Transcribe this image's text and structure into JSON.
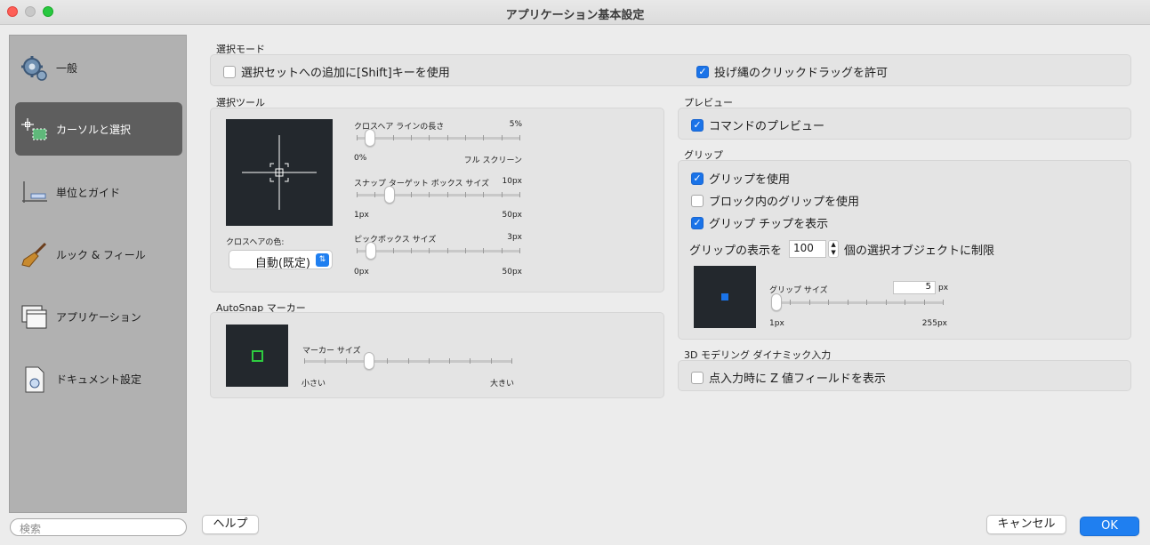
{
  "window": {
    "title": "アプリケーション基本設定"
  },
  "sidebar": {
    "items": [
      {
        "label": "一般",
        "icon": "gear-icon"
      },
      {
        "label": "カーソルと選択",
        "icon": "cursor-selection-icon",
        "active": true
      },
      {
        "label": "単位とガイド",
        "icon": "ruler-icon"
      },
      {
        "label": "ルック & フィール",
        "icon": "brush-icon"
      },
      {
        "label": "アプリケーション",
        "icon": "windows-icon"
      },
      {
        "label": "ドキュメント設定",
        "icon": "document-icon"
      }
    ],
    "search_placeholder": "検索"
  },
  "selection_mode": {
    "label": "選択モード",
    "shift_add": {
      "label": "選択セットへの追加に[Shift]キーを使用",
      "checked": false
    },
    "lasso": {
      "label": "投げ縄のクリックドラッグを許可",
      "checked": true
    }
  },
  "selection_tools": {
    "label": "選択ツール",
    "crosshair_color_label": "クロスヘアの色:",
    "crosshair_color_value": "自動(既定)",
    "crosshair_length": {
      "label": "クロスヘア ラインの長さ",
      "value": "5%",
      "min": "0%",
      "max": "フル スクリーン",
      "fraction": 0.05
    },
    "snap_box": {
      "label": "スナップ ターゲット ボックス サイズ",
      "value": "10px",
      "min": "1px",
      "max": "50px",
      "fraction": 0.18
    },
    "pickbox": {
      "label": "ピックボックス サイズ",
      "value": "3px",
      "min": "0px",
      "max": "50px",
      "fraction": 0.06
    }
  },
  "autosnap": {
    "label": "AutoSnap マーカー",
    "marker_size": {
      "label": "マーカー サイズ",
      "min": "小さい",
      "max": "大きい",
      "fraction": 0.3
    },
    "marker_color": "#2ecc40"
  },
  "preview": {
    "label": "プレビュー",
    "command_preview": {
      "label": "コマンドのプレビュー",
      "checked": true
    }
  },
  "grips": {
    "label": "グリップ",
    "use_grips": {
      "label": "グリップを使用",
      "checked": true
    },
    "use_block_grips": {
      "label": "ブロック内のグリップを使用",
      "checked": false
    },
    "show_tips": {
      "label": "グリップ チップを表示",
      "checked": true
    },
    "limit_prefix": "グリップの表示を",
    "limit_value": "100",
    "limit_suffix": "個の選択オブジェクトに制限",
    "grip_size": {
      "label": "グリップ サイズ",
      "value": "5",
      "unit": "px",
      "min": "1px",
      "max": "255px",
      "fraction": 0.0
    },
    "grip_color": "#1a73e8"
  },
  "modeling3d": {
    "label": "3D モデリング ダイナミック入力",
    "z_field": {
      "label": "点入力時に Z 値フィールドを表示",
      "checked": false
    }
  },
  "buttons": {
    "help": "ヘルプ",
    "cancel": "キャンセル",
    "ok": "OK"
  }
}
